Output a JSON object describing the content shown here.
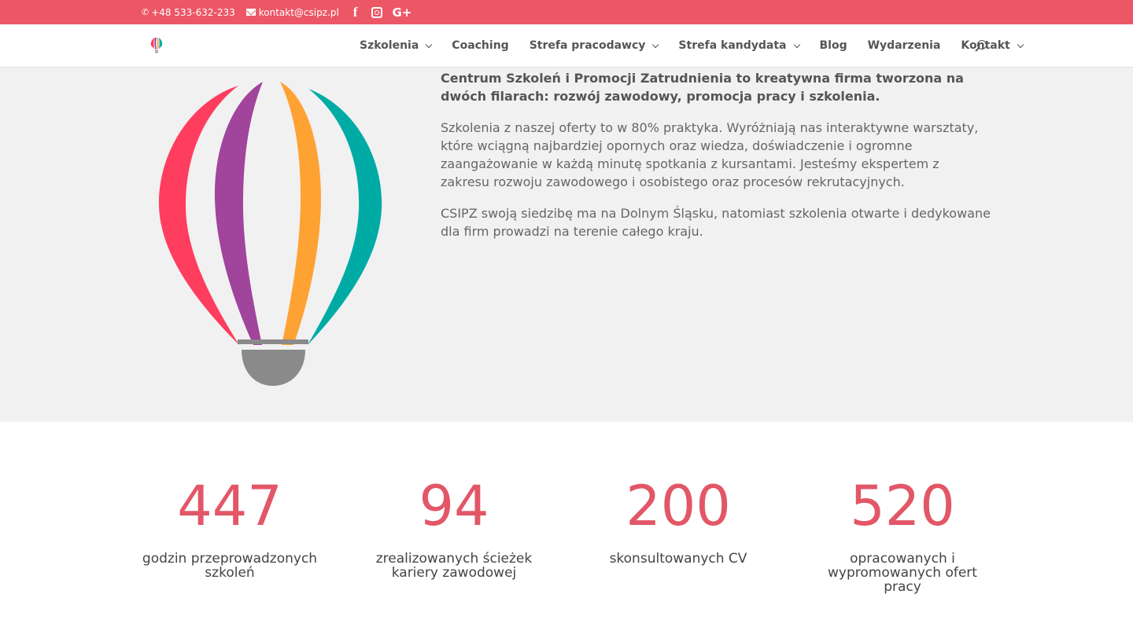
{
  "topbar": {
    "phone": "+48 533-632-233",
    "email": "kontakt@csipz.pl",
    "social": [
      "facebook-icon",
      "instagram-icon",
      "google-plus-icon"
    ],
    "google_plus_label": "G+",
    "facebook_label": "f",
    "background_color": "#ec5766"
  },
  "nav": {
    "items": [
      {
        "label": "Szkolenia",
        "dropdown": true
      },
      {
        "label": "Coaching",
        "dropdown": false
      },
      {
        "label": "Strefa pracodawcy",
        "dropdown": true
      },
      {
        "label": "Strefa kandydata",
        "dropdown": true
      },
      {
        "label": "Blog",
        "dropdown": false
      },
      {
        "label": "Wydarzenia",
        "dropdown": false
      },
      {
        "label": "Kontakt",
        "dropdown": true
      }
    ]
  },
  "about": {
    "lead": "Centrum Szkoleń i Promocji Zatrudnienia to kreatywna firma tworzona na dwóch filarach: rozwój zawodowy, promocja pracy i szkolenia.",
    "paragraph1": "Szkolenia z naszej oferty to w 80% praktyka. Wyróżniają nas interaktywne warsztaty, które wciągną najbardziej opornych oraz wiedza, doświadczenie i ogromne zaangażowanie w każdą minutę spotkania z kursantami. Jesteśmy ekspertem z zakresu rozwoju zawodowego i osobistego oraz procesów rekrutacyjnych.",
    "paragraph2": "CSIPZ swoją siedzibę ma na Dolnym Śląsku, natomiast szkolenia otwarte i dedykowane dla firm prowadzi na terenie całego kraju.",
    "balloon_colors": [
      "#ff3d5f",
      "#a0449c",
      "#ffa234",
      "#00aba5",
      "#8a8a8a"
    ]
  },
  "stats": [
    {
      "number": "447",
      "label": "godzin przeprowadzonych szkoleń"
    },
    {
      "number": "94",
      "label": "zrealizowanych ścieżek kariery zawodowej"
    },
    {
      "number": "200",
      "label": "skonsultowanych CV"
    },
    {
      "number": "520",
      "label": "opracowanych i wypromowanych ofert pracy"
    }
  ],
  "accent_color": "#e25767"
}
